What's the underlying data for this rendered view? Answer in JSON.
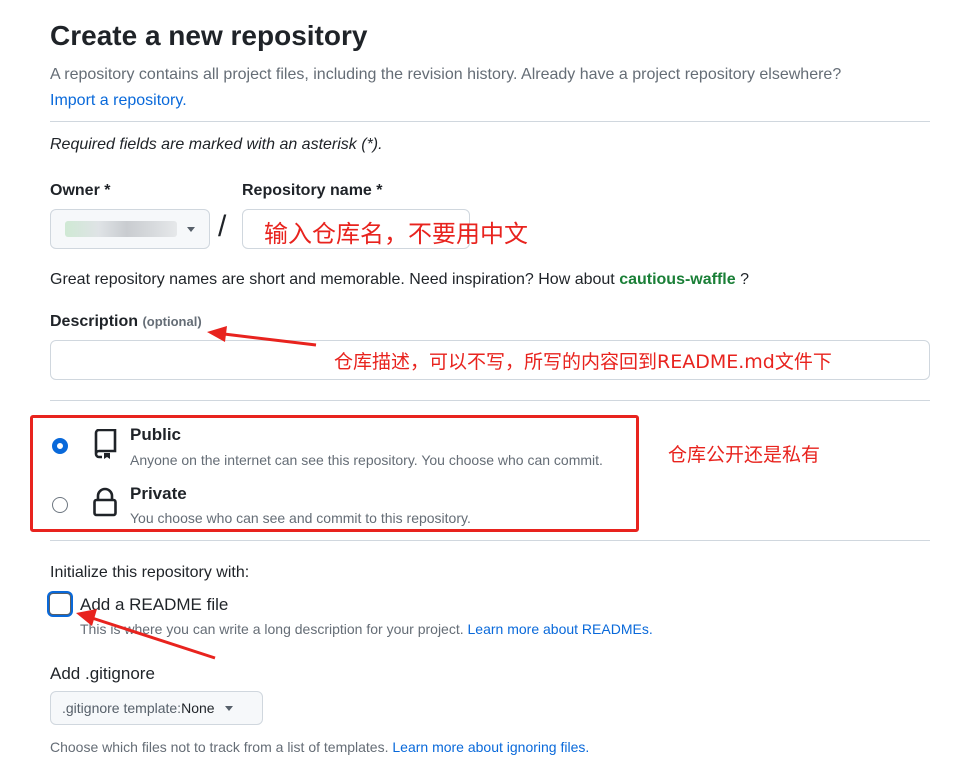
{
  "header": {
    "title": "Create a new repository",
    "subtitle": "A repository contains all project files, including the revision history. Already have a project repository elsewhere?",
    "import_link": "Import a repository."
  },
  "required_note": "Required fields are marked with an asterisk (*).",
  "owner": {
    "label": "Owner *",
    "value": ""
  },
  "repo_name": {
    "label": "Repository name *",
    "separator": "/",
    "annotation": "输入仓库名，不要用中文"
  },
  "inspiration": {
    "text": "Great repository names are short and memorable. Need inspiration? How about",
    "suggestion": "cautious-waffle",
    "suffix": "?"
  },
  "description": {
    "label": "Description",
    "optional": "(optional)",
    "annotation": "仓库描述，可以不写，所写的内容回到README.md文件下"
  },
  "visibility": {
    "annotation": "仓库公开还是私有",
    "public": {
      "label": "Public",
      "desc": "Anyone on the internet can see this repository. You choose who can commit."
    },
    "private": {
      "label": "Private",
      "desc": "You choose who can see and commit to this repository."
    }
  },
  "initialize": {
    "title": "Initialize this repository with:",
    "readme_label": "Add a README file",
    "readme_desc": "This is where you can write a long description for your project.",
    "readme_link": "Learn more about READMEs."
  },
  "gitignore": {
    "label": "Add .gitignore",
    "select_prefix": ".gitignore template:",
    "select_value": "None",
    "desc": "Choose which files not to track from a list of templates.",
    "desc_link": "Learn more about ignoring files."
  },
  "colors": {
    "accent": "#0969da",
    "annotation": "#e8231e",
    "suggestion": "#1a7f37"
  }
}
